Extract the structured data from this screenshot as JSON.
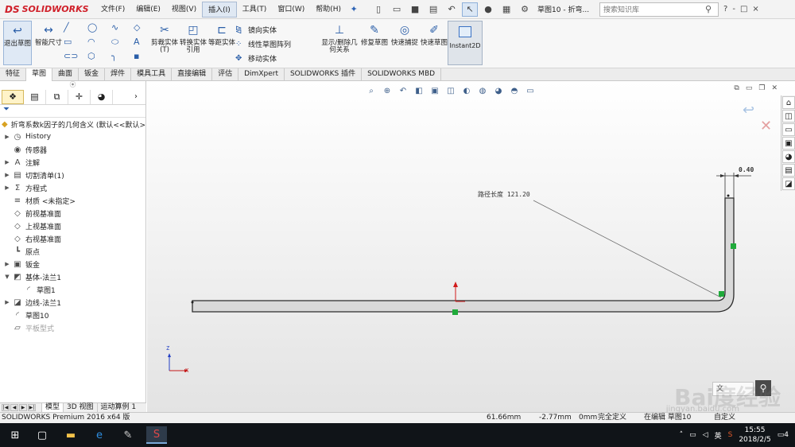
{
  "titlebar": {
    "logo": "SOLIDWORKS",
    "menu": [
      "文件(F)",
      "编辑(E)",
      "视图(V)",
      "插入(I)",
      "工具(T)",
      "窗口(W)",
      "帮助(H)"
    ],
    "active_menu": "插入(I)",
    "doc_title": "草图10 - 折弯...",
    "search_placeholder": "搜索知识库",
    "win_controls": [
      "?",
      "-",
      "□",
      "×"
    ]
  },
  "command_manager": {
    "exit_sketch": "退出草图",
    "smart_dim": "智能尺寸",
    "trim": "剪裁实体(T)",
    "convert": "转换实体引用",
    "offset": "等距实体",
    "mirror": "镜向实体",
    "linear_pattern": "线性草图阵列",
    "move": "移动实体",
    "show_delete": "显示/删除几何关系",
    "repair": "修复草图",
    "quick_snaps": "快速捕捉",
    "rapid_sketch": "快速草图",
    "instant2d": "Instant2D"
  },
  "tabs": [
    "特征",
    "草图",
    "曲面",
    "钣金",
    "焊件",
    "模具工具",
    "直接编辑",
    "评估",
    "DimXpert",
    "SOLIDWORKS 插件",
    "SOLIDWORKS MBD"
  ],
  "active_tab": "草图",
  "feature_tree": {
    "root": "折弯系数k因子的几何含义  (默认<<默认>",
    "items": [
      {
        "label": "History",
        "arrow": "▶",
        "icon": "history-icon",
        "indent": 0
      },
      {
        "label": "传感器",
        "arrow": "",
        "icon": "sensor-icon",
        "indent": 0
      },
      {
        "label": "注解",
        "arrow": "▶",
        "icon": "annotation-icon",
        "indent": 0
      },
      {
        "label": "切割清单(1)",
        "arrow": "▶",
        "icon": "cutlist-icon",
        "indent": 0
      },
      {
        "label": "方程式",
        "arrow": "▶",
        "icon": "equation-icon",
        "indent": 0
      },
      {
        "label": "材质 <未指定>",
        "arrow": "",
        "icon": "material-icon",
        "indent": 0
      },
      {
        "label": "前视基准面",
        "arrow": "",
        "icon": "plane-icon",
        "indent": 0
      },
      {
        "label": "上视基准面",
        "arrow": "",
        "icon": "plane-icon",
        "indent": 0
      },
      {
        "label": "右视基准面",
        "arrow": "",
        "icon": "plane-icon",
        "indent": 0
      },
      {
        "label": "原点",
        "arrow": "",
        "icon": "origin-icon",
        "indent": 0
      },
      {
        "label": "钣金",
        "arrow": "▶",
        "icon": "sheetmetal-icon",
        "indent": 0
      },
      {
        "label": "基体-法兰1",
        "arrow": "▼",
        "icon": "baseflange-icon",
        "indent": 0
      },
      {
        "label": "草图1",
        "arrow": "",
        "icon": "sketch-icon",
        "indent": 1
      },
      {
        "label": "边线-法兰1",
        "arrow": "▶",
        "icon": "edgeflange-icon",
        "indent": 0
      },
      {
        "label": "草图10",
        "arrow": "",
        "icon": "sketch-icon",
        "indent": 0
      },
      {
        "label": "平板型式",
        "arrow": "",
        "icon": "flatpattern-icon",
        "indent": 0,
        "dim": true
      }
    ]
  },
  "bottom_tabs": [
    "模型",
    "3D 视图",
    "运动算例 1"
  ],
  "active_bottom_tab": "模型",
  "graphics": {
    "path_length_label": "路径长度 121.20",
    "thickness_label": "0.40",
    "triad_z": "Z",
    "triad_x": "X",
    "watermark": "Bai度经验",
    "watermark_url": "jingyan.baidu.com",
    "search_text": "文"
  },
  "status": {
    "app": "SOLIDWORKS Premium 2016 x64 版",
    "x": "61.66mm",
    "y": "-2.77mm",
    "z": "0mm",
    "defined": "完全定义",
    "editing": "在编辑 草图10",
    "units": "自定义"
  },
  "taskbar": {
    "time": "15:55",
    "date": "2018/2/5",
    "ime": "英",
    "notif": "4"
  }
}
